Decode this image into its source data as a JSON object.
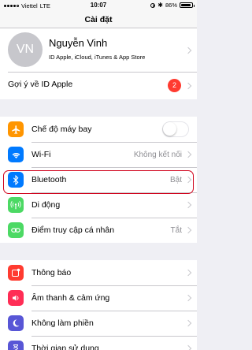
{
  "status_bar": {
    "carrier": "Viettel",
    "network": "LTE",
    "time": "10:07",
    "battery": "86%"
  },
  "nav": {
    "title": "Cài đặt"
  },
  "profile": {
    "initials": "VN",
    "name": "Nguyễn Vinh",
    "subtitle": "ID Apple, iCloud, iTunes & App Store"
  },
  "suggestion": {
    "label": "Gợi ý về ID Apple",
    "badge": "2"
  },
  "connectivity": [
    {
      "label": "Chế độ máy bay",
      "icon": "airplane-icon",
      "color": "#ff9500"
    },
    {
      "label": "Wi-Fi",
      "value": "Không kết nối",
      "icon": "wifi-icon",
      "color": "#007aff"
    },
    {
      "label": "Bluetooth",
      "value": "Bật",
      "icon": "bluetooth-icon",
      "color": "#007aff"
    },
    {
      "label": "Di động",
      "icon": "cellular-icon",
      "color": "#4cd964"
    },
    {
      "label": "Điểm truy cập cá nhân",
      "value": "Tắt",
      "icon": "hotspot-icon",
      "color": "#4cd964"
    }
  ],
  "general": [
    {
      "label": "Thông báo",
      "icon": "notifications-icon",
      "color": "#ff3b30"
    },
    {
      "label": "Âm thanh & cảm ứng",
      "icon": "sounds-icon",
      "color": "#ff2d55"
    },
    {
      "label": "Không làm phiền",
      "icon": "moon-icon",
      "color": "#5856d6"
    },
    {
      "label": "Thời gian sử dụng",
      "icon": "screen-time-icon",
      "color": "#5856d6"
    }
  ],
  "colors": {
    "highlight": "#d0021b"
  }
}
